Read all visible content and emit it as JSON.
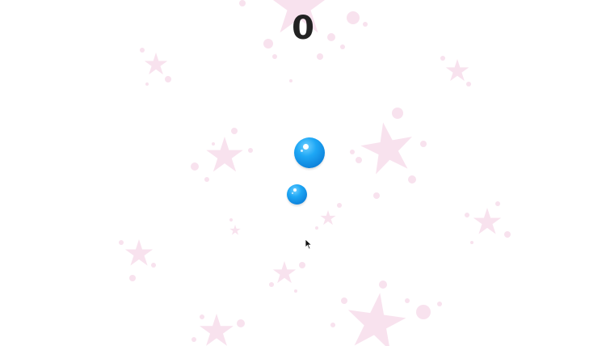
{
  "game": {
    "score": "0",
    "balls": [
      {
        "name": "ball-large",
        "color": "#1ea7f5"
      },
      {
        "name": "ball-small",
        "color": "#1ea7f5"
      }
    ],
    "background_decoration": "pink-stars",
    "colors": {
      "star": "#f7e3ef",
      "background": "#ffffff",
      "score_text": "#222222"
    }
  }
}
